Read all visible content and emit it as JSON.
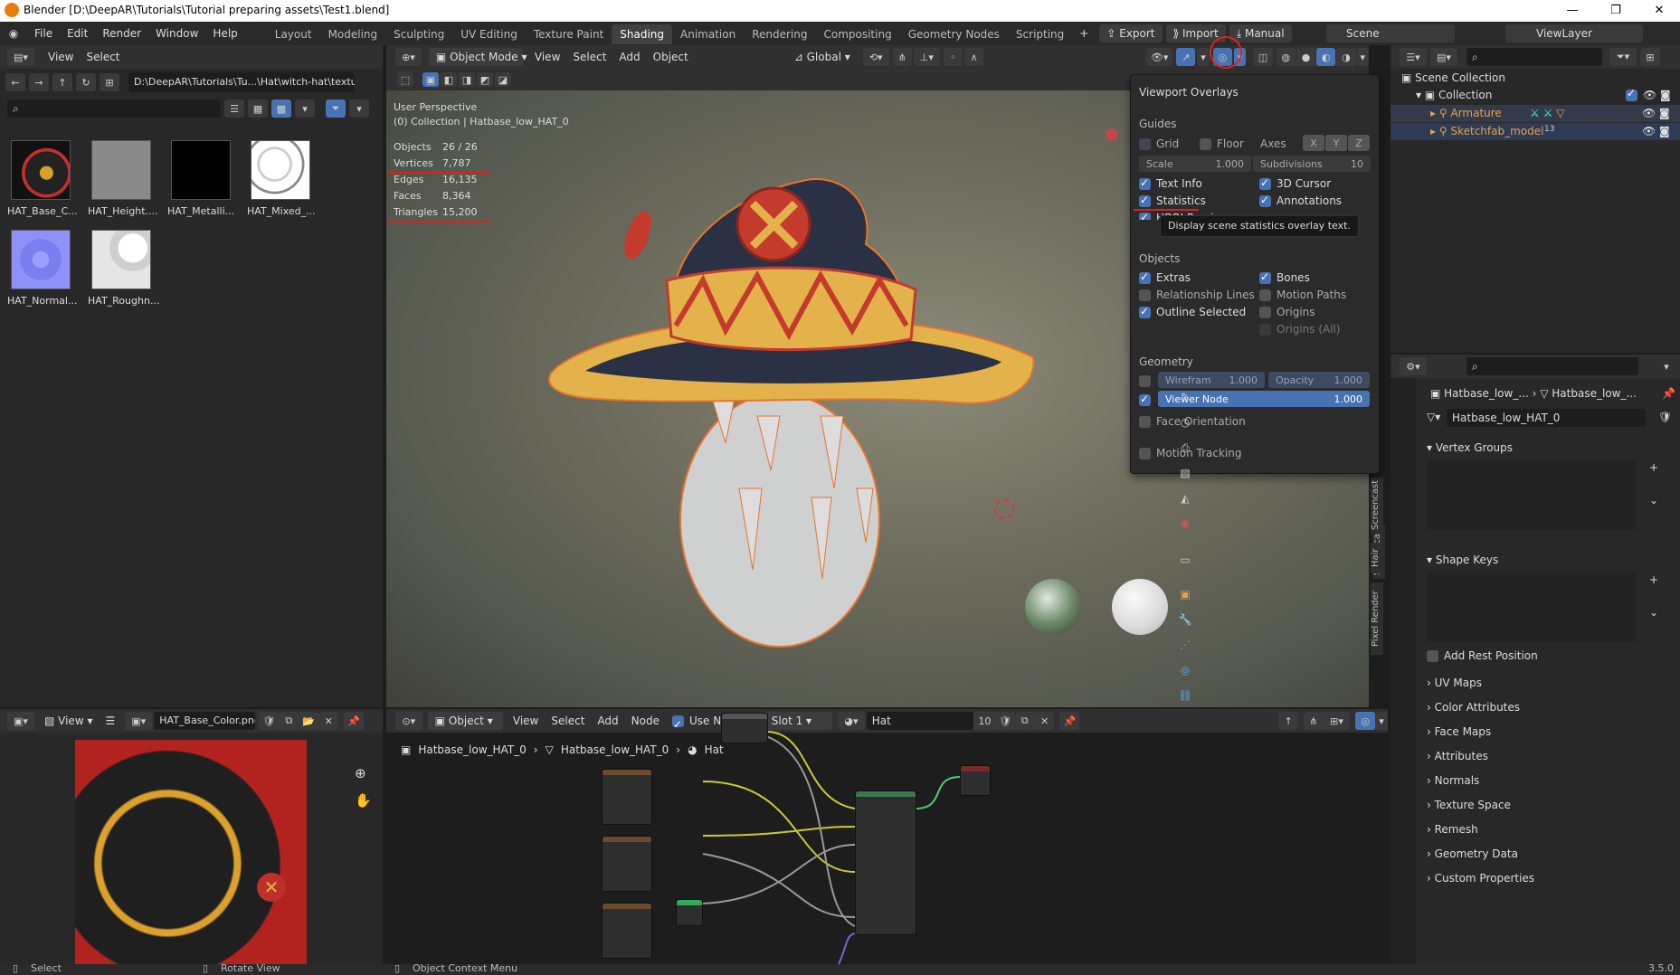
{
  "window": {
    "title": "Blender [D:\\DeepAR\\Tutorials\\Tutorial preparing assets\\Test1.blend]"
  },
  "menu": [
    "File",
    "Edit",
    "Render",
    "Window",
    "Help"
  ],
  "workspaces": [
    "Layout",
    "Modeling",
    "Sculpting",
    "UV Editing",
    "Texture Paint",
    "Shading",
    "Animation",
    "Rendering",
    "Compositing",
    "Geometry Nodes",
    "Scripting"
  ],
  "active_workspace": "Shading",
  "toolbar": {
    "export": "Export",
    "import": "Import",
    "manual": "Manual",
    "scene": "Scene",
    "viewlayer": "ViewLayer"
  },
  "file_browser": {
    "menu": [
      "View",
      "Select"
    ],
    "path": "D:\\DeepAR\\Tutorials\\Tu...\\Hat\\witch-hat\\textures\\",
    "files": [
      "HAT_Base_C...",
      "HAT_Height....",
      "HAT_Metalli...",
      "HAT_Mixed_...",
      "HAT_Normal...",
      "HAT_Roughn..."
    ]
  },
  "viewport": {
    "header": {
      "mode": "Object Mode",
      "menu": [
        "View",
        "Select",
        "Add",
        "Object"
      ],
      "orientation": "Global"
    },
    "perspective": "User Perspective",
    "collection": "(0) Collection | Hatbase_low_HAT_0",
    "stats": [
      {
        "label": "Objects",
        "value": "26 / 26"
      },
      {
        "label": "Vertices",
        "value": "7,787"
      },
      {
        "label": "Edges",
        "value": "16,135"
      },
      {
        "label": "Faces",
        "value": "8,364"
      },
      {
        "label": "Triangles",
        "value": "15,200"
      }
    ],
    "side_tabs": [
      "Screencast",
      "Hair",
      "Pixel Render"
    ]
  },
  "overlays": {
    "title": "Viewport Overlays",
    "guides": "Guides",
    "grid": "Grid",
    "floor": "Floor",
    "axes": "Axes",
    "x": "X",
    "y": "Y",
    "z": "Z",
    "scale_label": "Scale",
    "scale_value": "1.000",
    "subdiv_label": "Subdivisions",
    "subdiv_value": "10",
    "text_info": "Text Info",
    "cursor_3d": "3D Cursor",
    "statistics": "Statistics",
    "annotations": "Annotations",
    "hdri": "HDRI Preview",
    "tooltip": "Display scene statistics overlay text.",
    "objects": "Objects",
    "extras": "Extras",
    "bones": "Bones",
    "relationship": "Relationship Lines",
    "motion_paths": "Motion Paths",
    "outline": "Outline Selected",
    "origins": "Origins",
    "origins_all": "Origins (All)",
    "geometry": "Geometry",
    "wireframe_label": "Wirefram",
    "wireframe_value": "1.000",
    "opacity_label": "Opacity",
    "opacity_value": "1.000",
    "viewer_node_label": "Viewer Node",
    "viewer_node_value": "1.000",
    "face_orientation": "Face Orientation",
    "motion_tracking": "Motion Tracking"
  },
  "outliner": {
    "scene_collection": "Scene Collection",
    "collection": "Collection",
    "armature": "Armature",
    "sketchfab": "Sketchfab_model",
    "counts": "13"
  },
  "properties": {
    "breadcrumb1": "Hatbase_low_...",
    "breadcrumb2": "Hatbase_low_...",
    "mesh_name": "Hatbase_low_HAT_0",
    "vertex_groups": "Vertex Groups",
    "shape_keys": "Shape Keys",
    "add_rest": "Add Rest Position",
    "sections": [
      "UV Maps",
      "Color Attributes",
      "Face Maps",
      "Attributes",
      "Normals",
      "Texture Space",
      "Remesh",
      "Geometry Data",
      "Custom Properties"
    ]
  },
  "image_editor": {
    "view": "View",
    "image": "HAT_Base_Color.png"
  },
  "node_editor": {
    "mode": "Object",
    "menu": [
      "View",
      "Select",
      "Add",
      "Node"
    ],
    "use_nodes": "Use Nodes",
    "slot": "Slot 1",
    "material": "Hat",
    "users": "10",
    "breadcrumb": [
      "Hatbase_low_HAT_0",
      "Hatbase_low_HAT_0",
      "Hat"
    ]
  },
  "statusbar": {
    "select": "Select",
    "rotate": "Rotate View",
    "context": "Object Context Menu",
    "version": "3.5.0"
  }
}
